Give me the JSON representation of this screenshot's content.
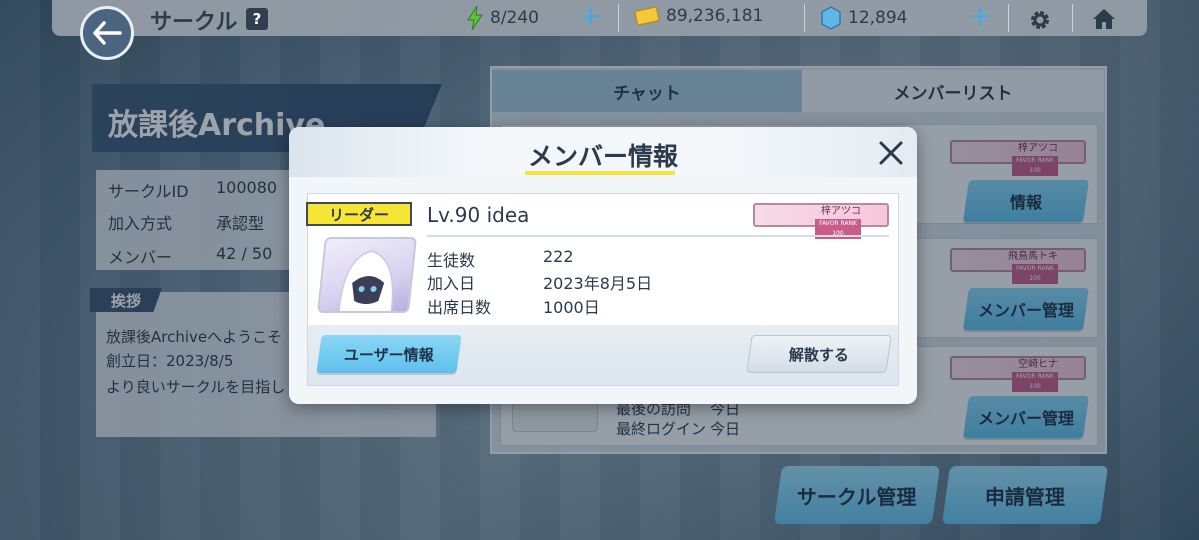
{
  "header": {
    "title": "サークル",
    "help": "?",
    "ap": "8/240",
    "credits": "89,236,181",
    "pyroxene": "12,894"
  },
  "circle": {
    "name": "放課後Archive",
    "rows": [
      {
        "label": "サークルID",
        "value": "100080"
      },
      {
        "label": "加入方式",
        "value": "承認型"
      },
      {
        "label": "メンバー",
        "value": "42 / 50"
      }
    ],
    "greeting_tag": "挨拶",
    "greeting_lines": [
      "放課後Archiveへようこそ",
      "創立日：2023/8/5",
      "より良いサークルを目指し"
    ]
  },
  "tabs": {
    "chat": "チャット",
    "members": "メンバーリスト"
  },
  "member_cards": [
    {
      "badge": "梓アツコ",
      "button": "情報"
    },
    {
      "badge": "飛鳥馬トキ",
      "button": "メンバー管理"
    },
    {
      "badge": "空崎ヒナ",
      "button": "メンバー管理",
      "line1": "最後の訪問",
      "line1_val": "今日",
      "line2": "最終ログイン",
      "line2_val": "今日"
    }
  ],
  "favor_rank_label": "FAVOR RANK 100",
  "bottom_buttons": {
    "circle_manage": "サークル管理",
    "request_manage": "申請管理"
  },
  "modal": {
    "title": "メンバー情報",
    "leader_badge": "リーダー",
    "player": "Lv.90 idea",
    "badge": "梓アツコ",
    "stats": [
      {
        "label": "生徒数",
        "value": "222"
      },
      {
        "label": "加入日",
        "value": "2023年8月5日"
      },
      {
        "label": "出席日数",
        "value": "1000日"
      }
    ],
    "user_info_button": "ユーザー情報",
    "dismiss_button": "解散する"
  },
  "colors": {
    "accent_blue": "#5fc0ec",
    "leader_yellow": "#f7e536",
    "title_underline": "#f4e33e",
    "dark_navy": "#2b3b4e"
  }
}
